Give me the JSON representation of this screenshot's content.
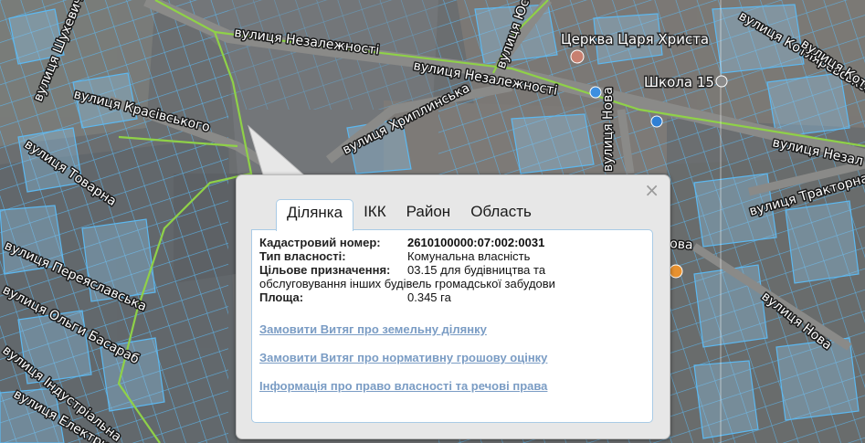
{
  "map": {
    "streets": [
      {
        "label": "вулиця Шухевича"
      },
      {
        "label": "вулиця Незалежності"
      },
      {
        "label": "вулиця Незалежності"
      },
      {
        "label": "вулиця Красівського"
      },
      {
        "label": "вулиця Хриплинська"
      },
      {
        "label": "вулиця Товарна"
      },
      {
        "label": "вулиця Переяславська"
      },
      {
        "label": "вулиця Ольги Басараб"
      },
      {
        "label": "вулиця Індустріальна"
      },
      {
        "label": "вулиця Електрична"
      },
      {
        "label": "вулиця Тракторна"
      },
      {
        "label": "вулиця Незал"
      },
      {
        "label": "вулиця Котляревського"
      },
      {
        "label": "вулиця Котляревського"
      },
      {
        "label": "вулиця Нова"
      },
      {
        "label": "вулиця Нова"
      },
      {
        "label": "вулиця Юсова"
      },
      {
        "label": "ова"
      }
    ],
    "pois": [
      {
        "label": "Церква Царя Христа",
        "icon": "church-pin-icon"
      },
      {
        "label": "Школа 15",
        "icon": "school-pin-icon"
      }
    ],
    "colors": {
      "parcel": "#5cb8f0",
      "boundary": "#8fd148",
      "accent": "#7a9cc4"
    }
  },
  "popup": {
    "close_label": "×",
    "tabs": [
      {
        "label": "Ділянка",
        "active": true
      },
      {
        "label": "ІКК",
        "active": false
      },
      {
        "label": "Район",
        "active": false
      },
      {
        "label": "Область",
        "active": false
      }
    ],
    "fields": [
      {
        "label": "Кадастровий номер:",
        "value": "2610100000:07:002:0031"
      },
      {
        "label": "Тип власності:",
        "value": "Комунальна власність"
      },
      {
        "label": "Цільове призначення:",
        "value": "03.15 для будівництва та",
        "value_cont": "обслуговування інших будівель громадської забудови"
      },
      {
        "label": "Площа:",
        "value": "0.345 га"
      }
    ],
    "links": [
      {
        "label": "Замовити Витяг про земельну ділянку"
      },
      {
        "label": "Замовити Витяг про нормативну грошову оцінку"
      },
      {
        "label": "Інформація про право власності та речові права"
      }
    ]
  }
}
